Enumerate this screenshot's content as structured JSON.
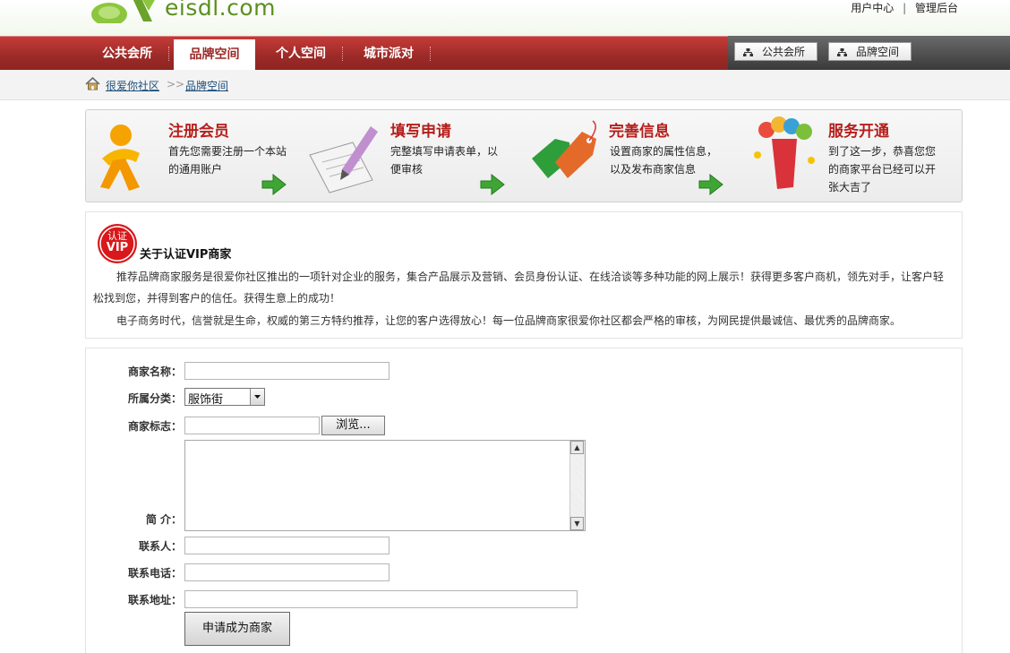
{
  "site": {
    "logo_text": "eisdl.com"
  },
  "top_links": {
    "user_center": "用户中心",
    "separator": "|",
    "admin": "管理后台"
  },
  "nav": {
    "items": [
      "公共会所",
      "品牌空间",
      "个人空间",
      "城市派对"
    ],
    "active_index": 1,
    "quick_buttons": [
      "公共会所",
      "品牌空间"
    ]
  },
  "breadcrumb": {
    "home": "很爱你社区",
    "arrow": ">>",
    "current": "品牌空间"
  },
  "steps": [
    {
      "title": "注册会员",
      "desc": [
        "首先您需要注册一个本站",
        "的通用账户"
      ],
      "icon": "member-figure"
    },
    {
      "title": "填写申请",
      "desc": [
        "完整填写申请表单，以",
        "便审核"
      ],
      "icon": "pen-paper"
    },
    {
      "title": "完善信息",
      "desc": [
        "设置商家的属性信息，",
        "以及发布商家信息"
      ],
      "icon": "sale-tags"
    },
    {
      "title": "服务开通",
      "desc": [
        "到了这一步，恭喜您您",
        "的商家平台已经可以开",
        "张大吉了"
      ],
      "icon": "open-balloons"
    }
  ],
  "about": {
    "badge_top": "认证",
    "badge_main": "VIP",
    "title": "关于认证VIP商家",
    "p1": "推荐品牌商家服务是很爱你社区推出的一项针对企业的服务，集合产品展示及营销、会员身份认证、在线洽谈等多种功能的网上展示！获得更多客户商机，领先对手，让客户轻松找到您，并得到客户的信任。获得生意上的成功！",
    "p2": "电子商务时代，信誉就是生命，权威的第三方特约推荐，让您的客户选得放心！每一位品牌商家很爱你社区都会严格的审核，为网民提供最诚信、最优秀的品牌商家。"
  },
  "form": {
    "name_label": "商家名称：",
    "category_label": "所属分类：",
    "category_value": "服饰街",
    "logo_label": "商家标志：",
    "browse_label": "浏览...",
    "intro_label": "简 介：",
    "contact_label": "联系人：",
    "phone_label": "联系电话：",
    "address_label": "联系地址：",
    "submit_label": "申请成为商家"
  },
  "colors": {
    "nav_red": "#9a2a27",
    "step_title": "#b51f1b",
    "logo_green": "#5b8f1f"
  }
}
